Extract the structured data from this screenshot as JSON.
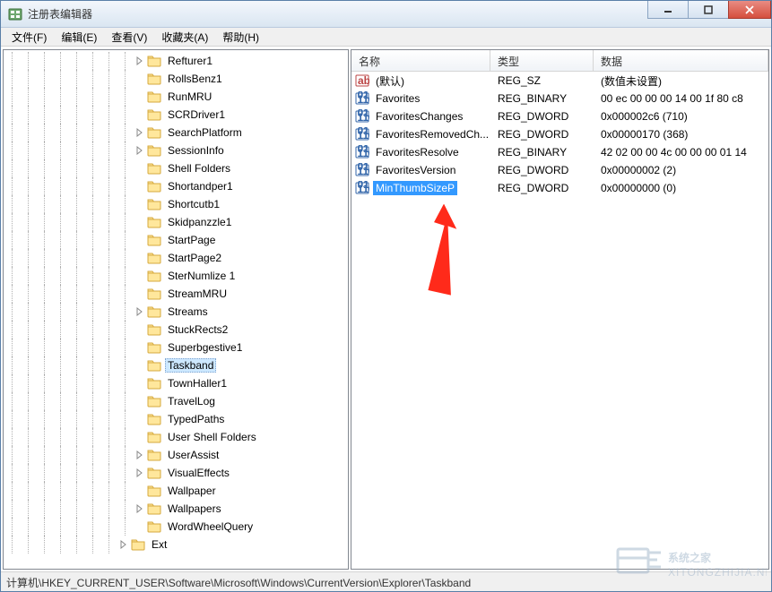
{
  "window": {
    "title": "注册表编辑器"
  },
  "menu": {
    "file": "文件(F)",
    "edit": "编辑(E)",
    "view": "查看(V)",
    "fav": "收藏夹(A)",
    "help": "帮助(H)"
  },
  "tree": {
    "indent_base": 8,
    "items": [
      {
        "label": "Refturer1",
        "expander": "closed"
      },
      {
        "label": "RollsBenz1",
        "expander": "none"
      },
      {
        "label": "RunMRU",
        "expander": "none"
      },
      {
        "label": "SCRDriver1",
        "expander": "none"
      },
      {
        "label": "SearchPlatform",
        "expander": "closed"
      },
      {
        "label": "SessionInfo",
        "expander": "closed"
      },
      {
        "label": "Shell Folders",
        "expander": "none"
      },
      {
        "label": "Shortandper1",
        "expander": "none"
      },
      {
        "label": "Shortcutb1",
        "expander": "none"
      },
      {
        "label": "Skidpanzzle1",
        "expander": "none"
      },
      {
        "label": "StartPage",
        "expander": "none"
      },
      {
        "label": "StartPage2",
        "expander": "none"
      },
      {
        "label": "SterNumlize 1",
        "expander": "none"
      },
      {
        "label": "StreamMRU",
        "expander": "none"
      },
      {
        "label": "Streams",
        "expander": "closed"
      },
      {
        "label": "StuckRects2",
        "expander": "none"
      },
      {
        "label": "Superbgestive1",
        "expander": "none"
      },
      {
        "label": "Taskband",
        "expander": "none",
        "selected": true
      },
      {
        "label": "TownHaller1",
        "expander": "none"
      },
      {
        "label": "TravelLog",
        "expander": "none"
      },
      {
        "label": "TypedPaths",
        "expander": "none"
      },
      {
        "label": "User Shell Folders",
        "expander": "none"
      },
      {
        "label": "UserAssist",
        "expander": "closed"
      },
      {
        "label": "VisualEffects",
        "expander": "closed"
      },
      {
        "label": "Wallpaper",
        "expander": "none"
      },
      {
        "label": "Wallpapers",
        "expander": "closed"
      },
      {
        "label": "WordWheelQuery",
        "expander": "none"
      },
      {
        "label": "Ext",
        "expander": "closed",
        "outdent": 1
      }
    ]
  },
  "values": {
    "columns": {
      "name": "名称",
      "type": "类型",
      "data": "数据"
    },
    "rows": [
      {
        "icon": "string",
        "name": "(默认)",
        "type": "REG_SZ",
        "data": "(数值未设置)"
      },
      {
        "icon": "binary",
        "name": "Favorites",
        "type": "REG_BINARY",
        "data": "00 ec 00 00 00 14 00 1f 80 c8"
      },
      {
        "icon": "binary",
        "name": "FavoritesChanges",
        "type": "REG_DWORD",
        "data": "0x000002c6 (710)"
      },
      {
        "icon": "binary",
        "name": "FavoritesRemovedCh...",
        "type": "REG_DWORD",
        "data": "0x00000170 (368)"
      },
      {
        "icon": "binary",
        "name": "FavoritesResolve",
        "type": "REG_BINARY",
        "data": "42 02 00 00 4c 00 00 00 01 14"
      },
      {
        "icon": "binary",
        "name": "FavoritesVersion",
        "type": "REG_DWORD",
        "data": "0x00000002 (2)"
      },
      {
        "icon": "binary",
        "name": "MinThumbSizeP",
        "type": "REG_DWORD",
        "data": "0x00000000 (0)",
        "selected": true
      }
    ]
  },
  "statusbar": {
    "path": "计算机\\HKEY_CURRENT_USER\\Software\\Microsoft\\Windows\\CurrentVersion\\Explorer\\Taskband"
  },
  "watermark": {
    "line1": "系统之家",
    "line2": "XITONGZHIJIA.NET"
  }
}
